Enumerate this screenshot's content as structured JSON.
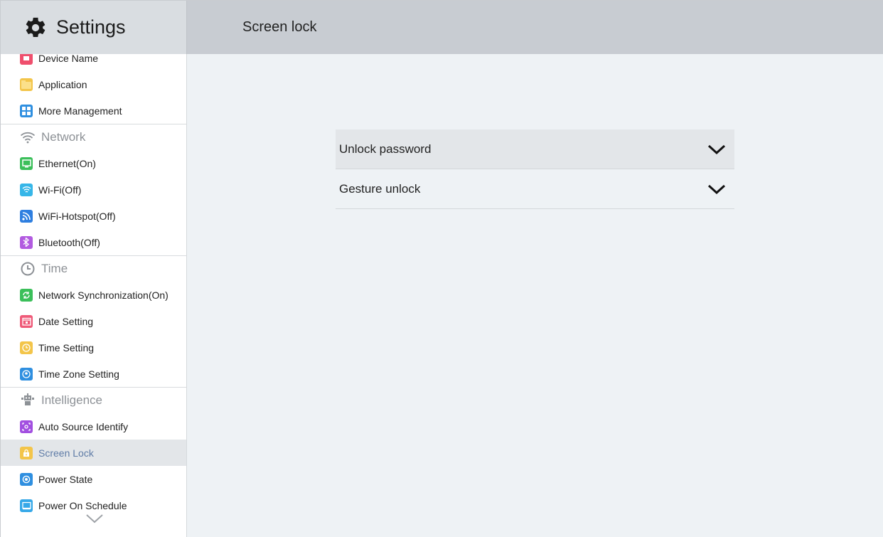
{
  "header": {
    "app_title": "Settings",
    "page_title": "Screen lock"
  },
  "sidebar": {
    "items": [
      {
        "kind": "item",
        "label": "Device Name",
        "icon": "device-name-icon",
        "color": "#ef4f6d",
        "partial": true
      },
      {
        "kind": "item",
        "label": "Application",
        "icon": "application-icon",
        "color": "#f3c54a"
      },
      {
        "kind": "item",
        "label": "More Management",
        "icon": "more-management-icon",
        "color": "#2f8fe0"
      },
      {
        "kind": "group",
        "label": "Network",
        "icon": "wifi-icon"
      },
      {
        "kind": "item",
        "label": "Ethernet(On)",
        "icon": "ethernet-icon",
        "color": "#3bbf5a"
      },
      {
        "kind": "item",
        "label": "Wi-Fi(Off)",
        "icon": "wifi-icon",
        "color": "#36b6e8"
      },
      {
        "kind": "item",
        "label": "WiFi-Hotspot(Off)",
        "icon": "hotspot-icon",
        "color": "#2f7fe0"
      },
      {
        "kind": "item",
        "label": "Bluetooth(Off)",
        "icon": "bluetooth-icon",
        "color": "#b25be0"
      },
      {
        "kind": "group",
        "label": "Time",
        "icon": "clock-icon"
      },
      {
        "kind": "item",
        "label": "Network Synchronization(On)",
        "icon": "sync-icon",
        "color": "#3bbf5a"
      },
      {
        "kind": "item",
        "label": "Date Setting",
        "icon": "calendar-icon",
        "color": "#ef5a78"
      },
      {
        "kind": "item",
        "label": "Time Setting",
        "icon": "clock-icon",
        "color": "#f3c54a"
      },
      {
        "kind": "item",
        "label": "Time Zone Setting",
        "icon": "timezone-icon",
        "color": "#2f8fe0"
      },
      {
        "kind": "group",
        "label": "Intelligence",
        "icon": "robot-icon"
      },
      {
        "kind": "item",
        "label": "Auto Source Identify",
        "icon": "auto-source-icon",
        "color": "#a24fe0"
      },
      {
        "kind": "item",
        "label": "Screen Lock",
        "icon": "lock-icon",
        "color": "#f3c54a",
        "active": true
      },
      {
        "kind": "item",
        "label": "Power State",
        "icon": "power-state-icon",
        "color": "#2f8fe0"
      },
      {
        "kind": "item",
        "label": "Power On Schedule",
        "icon": "schedule-icon",
        "color": "#36a8e8"
      }
    ],
    "more_icon": "chevron-down-icon"
  },
  "main": {
    "rows": [
      {
        "label": "Unlock password",
        "icon": "chevron-down-icon",
        "highlighted": true
      },
      {
        "label": "Gesture unlock",
        "icon": "chevron-down-icon",
        "highlighted": false
      }
    ]
  },
  "colors": {
    "header_bg": "#c8ccd2",
    "sidebar_bg": "#ffffff",
    "main_bg": "#eef2f5",
    "active_text": "#5e7ba6"
  }
}
